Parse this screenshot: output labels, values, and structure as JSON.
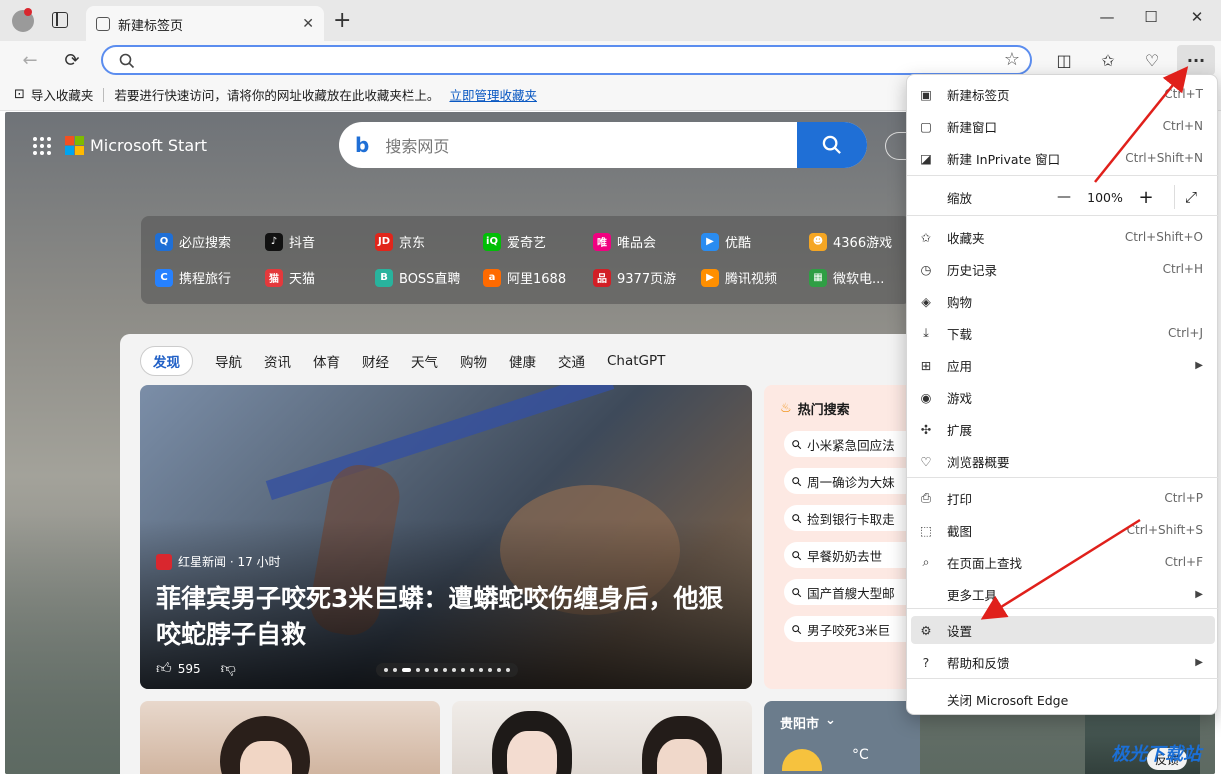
{
  "browser": {
    "tab_title": "新建标签页",
    "new_tab_symbol": "+",
    "window": {
      "minimize": "—",
      "maximize": "☐",
      "close": "✕"
    }
  },
  "favorites_bar": {
    "import_label": "导入收藏夹",
    "hint": "若要进行快速访问，请将你的网址收藏放在此收藏夹栏上。",
    "manage_link": "立即管理收藏夹"
  },
  "start_page": {
    "brand": "Microsoft Start",
    "search_placeholder": "搜索网页",
    "quick_links": [
      {
        "label": "必应搜索",
        "icon": "bing-search-icon",
        "color": "#1f6fd6",
        "glyph": "Q"
      },
      {
        "label": "抖音",
        "icon": "douyin-icon",
        "color": "#111111",
        "glyph": "♪"
      },
      {
        "label": "京东",
        "icon": "jd-icon",
        "color": "#e1251b",
        "glyph": "JD"
      },
      {
        "label": "爱奇艺",
        "icon": "iqiyi-icon",
        "color": "#00be06",
        "glyph": "iQ"
      },
      {
        "label": "唯品会",
        "icon": "vip-icon",
        "color": "#f10180",
        "glyph": "唯"
      },
      {
        "label": "优酷",
        "icon": "youku-icon",
        "color": "#2a8cf0",
        "glyph": "▶"
      },
      {
        "label": "4366游戏",
        "icon": "4366-icon",
        "color": "#f5a623",
        "glyph": "☻"
      },
      {
        "label": "携程旅行",
        "icon": "ctrip-icon",
        "color": "#2681ff",
        "glyph": "C"
      },
      {
        "label": "天猫",
        "icon": "tmall-icon",
        "color": "#e4393c",
        "glyph": "猫"
      },
      {
        "label": "BOSS直聘",
        "icon": "boss-icon",
        "color": "#28b39d",
        "glyph": "B"
      },
      {
        "label": "阿里1688",
        "icon": "ali1688-icon",
        "color": "#ff6a00",
        "glyph": "a"
      },
      {
        "label": "9377页游",
        "icon": "9377-icon",
        "color": "#d21f26",
        "glyph": "品"
      },
      {
        "label": "腾讯视频",
        "icon": "tencent-video-icon",
        "color": "#ff8f00",
        "glyph": "▶"
      },
      {
        "label": "微软电...",
        "icon": "microsoft-store-icon",
        "color": "#2f9e44",
        "glyph": "▦"
      }
    ],
    "feed_tabs": [
      "发现",
      "导航",
      "资讯",
      "体育",
      "财经",
      "天气",
      "购物",
      "健康",
      "交通",
      "ChatGPT"
    ],
    "hero": {
      "source": "红星新闻 · 17 小时",
      "headline": "菲律宾男子咬死3米巨蟒：遭蟒蛇咬伤缠身后，他狠咬蛇脖子自救",
      "likes": "595"
    },
    "hot_search": {
      "title": "热门搜索",
      "items": [
        "小米紧急回应法",
        "周一确诊为大妹",
        "捡到银行卡取走",
        "早餐奶奶去世",
        "国产首艘大型邮",
        "男子咬死3米巨"
      ]
    },
    "weather": {
      "city": "贵阳市",
      "unit": "°C"
    }
  },
  "menu": {
    "items": [
      {
        "label": "新建标签页",
        "shortcut": "Ctrl+T",
        "icon": "new-tab-icon"
      },
      {
        "label": "新建窗口",
        "shortcut": "Ctrl+N",
        "icon": "new-window-icon"
      },
      {
        "label": "新建 InPrivate 窗口",
        "shortcut": "Ctrl+Shift+N",
        "icon": "inprivate-icon"
      },
      {
        "label": "收藏夹",
        "shortcut": "Ctrl+Shift+O",
        "icon": "favorites-icon"
      },
      {
        "label": "历史记录",
        "shortcut": "Ctrl+H",
        "icon": "history-icon"
      },
      {
        "label": "购物",
        "shortcut": "",
        "icon": "shopping-icon"
      },
      {
        "label": "下载",
        "shortcut": "Ctrl+J",
        "icon": "download-icon"
      },
      {
        "label": "应用",
        "shortcut": "",
        "icon": "apps-icon",
        "submenu": true
      },
      {
        "label": "游戏",
        "shortcut": "",
        "icon": "games-icon"
      },
      {
        "label": "扩展",
        "shortcut": "",
        "icon": "extensions-icon"
      },
      {
        "label": "浏览器概要",
        "shortcut": "",
        "icon": "browser-essentials-icon"
      },
      {
        "label": "打印",
        "shortcut": "Ctrl+P",
        "icon": "print-icon"
      },
      {
        "label": "截图",
        "shortcut": "Ctrl+Shift+S",
        "icon": "screenshot-icon"
      },
      {
        "label": "在页面上查找",
        "shortcut": "Ctrl+F",
        "icon": "find-icon"
      },
      {
        "label": "更多工具",
        "shortcut": "",
        "icon": "",
        "submenu": true
      },
      {
        "label": "设置",
        "shortcut": "",
        "icon": "settings-icon",
        "highlighted": true
      },
      {
        "label": "帮助和反馈",
        "shortcut": "",
        "icon": "help-icon",
        "submenu": true
      },
      {
        "label": "关闭 Microsoft Edge",
        "shortcut": "",
        "icon": ""
      }
    ],
    "zoom": {
      "label": "缩放",
      "value": "100%",
      "minus": "—",
      "plus": "+"
    }
  },
  "watermark": "极光下载站",
  "feedback_label": "反馈"
}
